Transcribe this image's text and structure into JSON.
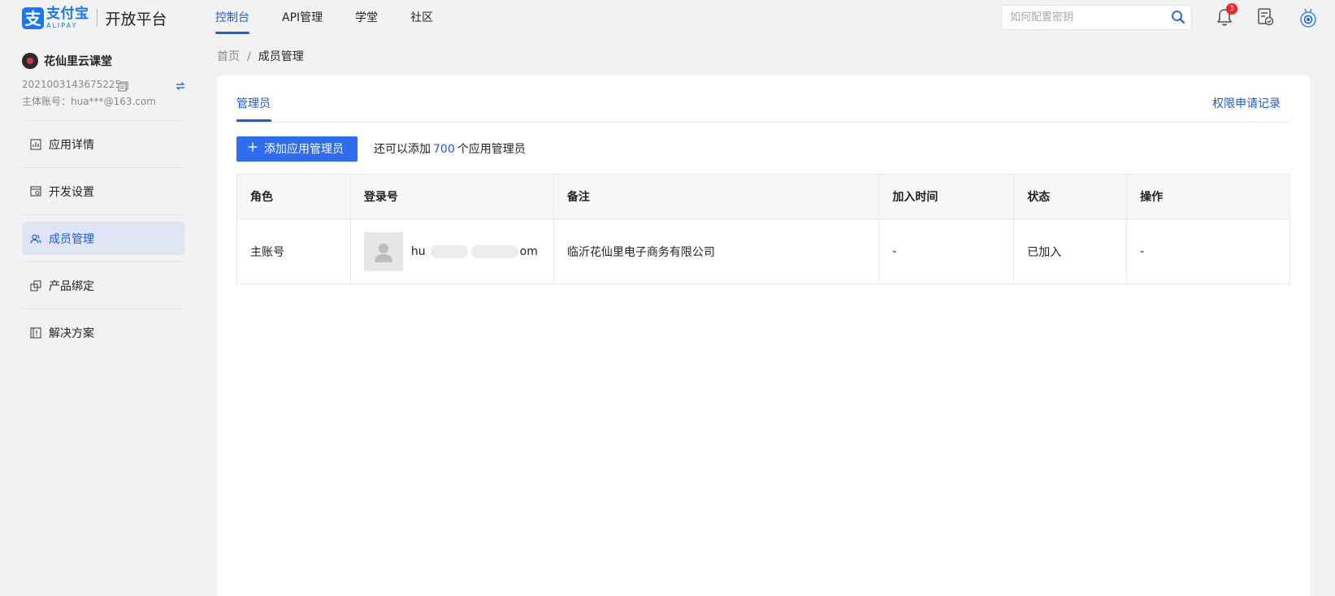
{
  "header": {
    "logo_cn": "支付宝",
    "logo_en": "ALIPAY",
    "title": "开放平台",
    "nav": [
      {
        "label": "控制台",
        "active": true
      },
      {
        "label": "API管理",
        "active": false
      },
      {
        "label": "学堂",
        "active": false
      },
      {
        "label": "社区",
        "active": false
      }
    ],
    "search_placeholder": "如何配置密钥",
    "notification_count": "3",
    "icons": [
      "search-icon",
      "bell-icon",
      "document-check-icon",
      "robot-icon"
    ]
  },
  "sidebar": {
    "app_name": "花仙里云课堂",
    "app_id": "2021003143675225",
    "owner_account": "主体账号：hua***@163.com",
    "menu": [
      {
        "label": "应用详情",
        "icon": "chart-icon",
        "active": false
      },
      {
        "label": "开发设置",
        "icon": "settings-panel-icon",
        "active": false
      },
      {
        "label": "成员管理",
        "icon": "members-icon",
        "active": true
      },
      {
        "label": "产品绑定",
        "icon": "link-icon",
        "active": false
      },
      {
        "label": "解决方案",
        "icon": "solution-icon",
        "active": false
      }
    ]
  },
  "breadcrumb": {
    "home": "首页",
    "separator": "/",
    "current": "成员管理"
  },
  "main": {
    "tab": "管理员",
    "permission_link": "权限申请记录",
    "add_button": "添加应用管理员",
    "quota_prefix": "还可以添加",
    "quota_number": "700",
    "quota_suffix": "个应用管理员",
    "table": {
      "columns": [
        "角色",
        "登录号",
        "备注",
        "加入时间",
        "状态",
        "操作"
      ],
      "rows": [
        {
          "role": "主账号",
          "login_prefix": "hu",
          "login_suffix": "om",
          "remark": "临沂花仙里电子商务有限公司",
          "join_time": "-",
          "status": "已加入",
          "action": "-"
        }
      ]
    }
  },
  "colors": {
    "brand_blue": "#1677ff",
    "accent": "#1b5ce4",
    "primary_button": "#2f6cf0",
    "badge_red": "#f5222d"
  }
}
